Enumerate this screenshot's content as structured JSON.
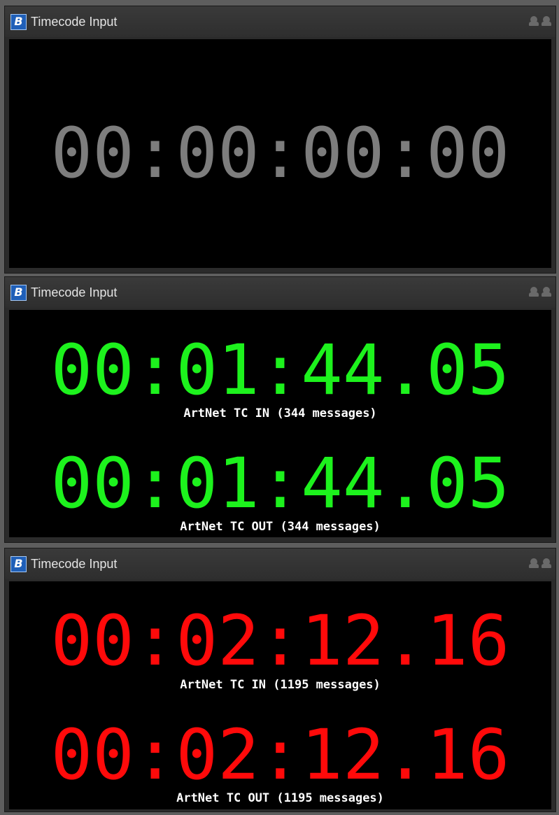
{
  "colors": {
    "idle": "#7d7d7d",
    "green": "#1df21d",
    "red": "#ff0a0a"
  },
  "panels": [
    {
      "title": "Timecode Input",
      "app_icon": "b-logo-icon",
      "timecode": "00:00:00:00"
    },
    {
      "title": "Timecode Input",
      "app_icon": "b-logo-icon",
      "tc_in": "00:01:44.05",
      "tc_in_caption": "ArtNet TC IN (344 messages)",
      "tc_out": "00:01:44.05",
      "tc_out_caption": "ArtNet TC OUT (344 messages)"
    },
    {
      "title": "Timecode Input",
      "app_icon": "b-logo-icon",
      "tc_in": "00:02:12.16",
      "tc_in_caption": "ArtNet TC IN (1195 messages)",
      "tc_out": "00:02:12.16",
      "tc_out_caption": "ArtNet TC OUT (1195 messages)"
    }
  ]
}
